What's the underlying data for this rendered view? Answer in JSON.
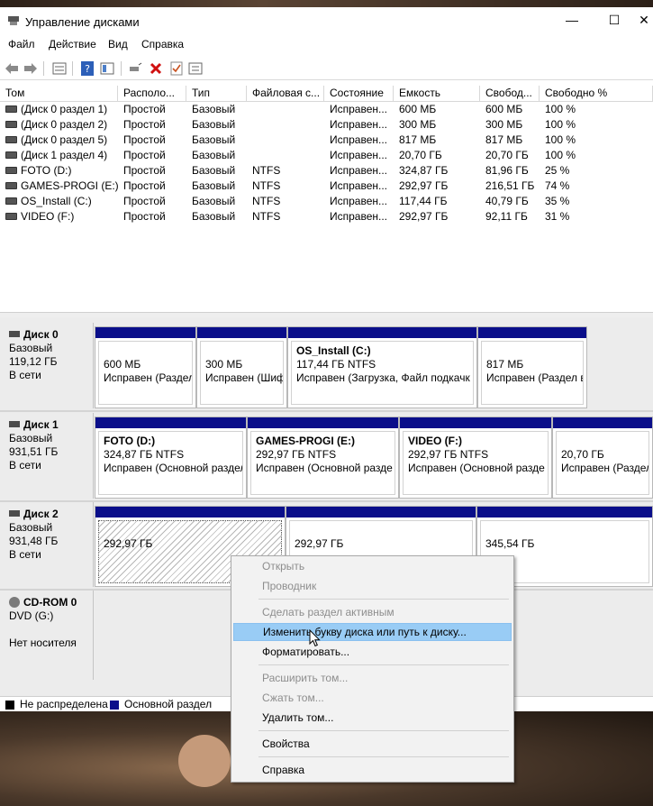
{
  "window": {
    "title": "Управление дисками",
    "minimize": "—",
    "maximize": "☐",
    "close": "✕"
  },
  "menu": [
    "Файл",
    "Действие",
    "Вид",
    "Справка"
  ],
  "toolbar": [
    "back-icon",
    "forward-icon",
    "properties-icon",
    "help-icon",
    "view-icon",
    "connect-icon",
    "delete-icon",
    "check-icon",
    "settings-icon"
  ],
  "columns": [
    "Том",
    "Располо...",
    "Тип",
    "Файловая с...",
    "Состояние",
    "Емкость",
    "Свобод...",
    "Свободно %"
  ],
  "volumes": [
    [
      "(Диск 0 раздел 1)",
      "Простой",
      "Базовый",
      "",
      "Исправен...",
      "600 МБ",
      "600 МБ",
      "100 %"
    ],
    [
      "(Диск 0 раздел 2)",
      "Простой",
      "Базовый",
      "",
      "Исправен...",
      "300 МБ",
      "300 МБ",
      "100 %"
    ],
    [
      "(Диск 0 раздел 5)",
      "Простой",
      "Базовый",
      "",
      "Исправен...",
      "817 МБ",
      "817 МБ",
      "100 %"
    ],
    [
      "(Диск 1 раздел 4)",
      "Простой",
      "Базовый",
      "",
      "Исправен...",
      "20,70 ГБ",
      "20,70 ГБ",
      "100 %"
    ],
    [
      "FOTO (D:)",
      "Простой",
      "Базовый",
      "NTFS",
      "Исправен...",
      "324,87 ГБ",
      "81,96 ГБ",
      "25 %"
    ],
    [
      "GAMES-PROGI (E:)",
      "Простой",
      "Базовый",
      "NTFS",
      "Исправен...",
      "292,97 ГБ",
      "216,51 ГБ",
      "74 %"
    ],
    [
      "OS_Install (C:)",
      "Простой",
      "Базовый",
      "NTFS",
      "Исправен...",
      "117,44 ГБ",
      "40,79 ГБ",
      "35 %"
    ],
    [
      "VIDEO (F:)",
      "Простой",
      "Базовый",
      "NTFS",
      "Исправен...",
      "292,97 ГБ",
      "92,11 ГБ",
      "31 %"
    ]
  ],
  "disks": [
    {
      "name": "Диск 0",
      "type": "Базовый",
      "size": "119,12 ГБ",
      "status": "В сети",
      "partitions": [
        {
          "name": "",
          "size": "600 МБ",
          "status": "Исправен (Раздел"
        },
        {
          "name": "",
          "size": "300 МБ",
          "status": "Исправен (Шиф"
        },
        {
          "name": "OS_Install  (C:)",
          "size": "117,44 ГБ NTFS",
          "status": "Исправен (Загрузка, Файл подкачк"
        },
        {
          "name": "",
          "size": "817 МБ",
          "status": "Исправен (Раздел в"
        }
      ]
    },
    {
      "name": "Диск 1",
      "type": "Базовый",
      "size": "931,51 ГБ",
      "status": "В сети",
      "partitions": [
        {
          "name": "FOTO  (D:)",
          "size": "324,87 ГБ NTFS",
          "status": "Исправен (Основной раздел"
        },
        {
          "name": "GAMES-PROGI  (E:)",
          "size": "292,97 ГБ NTFS",
          "status": "Исправен (Основной разде"
        },
        {
          "name": "VIDEO  (F:)",
          "size": "292,97 ГБ NTFS",
          "status": "Исправен (Основной разде"
        },
        {
          "name": "",
          "size": "20,70 ГБ",
          "status": "Исправен (Раздел в"
        }
      ]
    },
    {
      "name": "Диск 2",
      "type": "Базовый",
      "size": "931,48 ГБ",
      "status": "В сети",
      "partitions": [
        {
          "name": "",
          "size": "292,97 ГБ",
          "status": ""
        },
        {
          "name": "",
          "size": "292,97 ГБ",
          "status": ""
        },
        {
          "name": "",
          "size": "345,54 ГБ",
          "status": ""
        }
      ]
    },
    {
      "name": "CD-ROM 0",
      "type": "DVD (G:)",
      "size": "",
      "status": "Нет носителя",
      "partitions": []
    }
  ],
  "legend": {
    "unallocated": "Не распределена",
    "unallocated_color": "#000000",
    "primary": "Основной раздел",
    "primary_color": "#0a0e8a"
  },
  "context_menu": [
    {
      "label": "Открыть",
      "enabled": false
    },
    {
      "label": "Проводник",
      "enabled": false
    },
    {
      "label": "Сделать раздел активным",
      "enabled": false
    },
    {
      "label": "Изменить букву диска или путь к диску...",
      "enabled": true,
      "highlighted": true
    },
    {
      "label": "Форматировать...",
      "enabled": true
    },
    {
      "label": "Расширить том...",
      "enabled": false
    },
    {
      "label": "Сжать том...",
      "enabled": false
    },
    {
      "label": "Удалить том...",
      "enabled": true
    },
    {
      "label": "Свойства",
      "enabled": true
    },
    {
      "label": "Справка",
      "enabled": true
    }
  ]
}
